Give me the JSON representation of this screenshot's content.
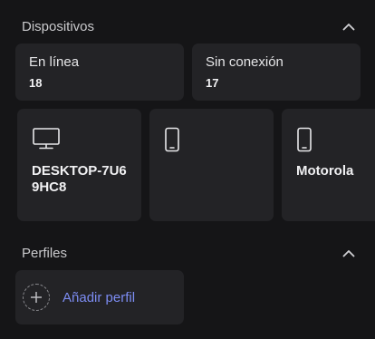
{
  "devices_section": {
    "title": "Dispositivos",
    "chevron_icon": "chevron-up-icon"
  },
  "status": {
    "online": {
      "label": "En línea",
      "count": "18"
    },
    "offline": {
      "label": "Sin conexión",
      "count": "17"
    }
  },
  "devices": [
    {
      "icon": "monitor-icon",
      "name": "DESKTOP-7U69HC8"
    },
    {
      "icon": "phone-icon",
      "name": ""
    },
    {
      "icon": "phone-icon",
      "name": "Motorola"
    }
  ],
  "profiles_section": {
    "title": "Perfiles",
    "chevron_icon": "chevron-up-icon",
    "add_label": "Añadir perfil",
    "add_icon": "plus-icon"
  },
  "colors": {
    "background": "#151517",
    "card": "#232326",
    "accent": "#7c8cf2"
  }
}
